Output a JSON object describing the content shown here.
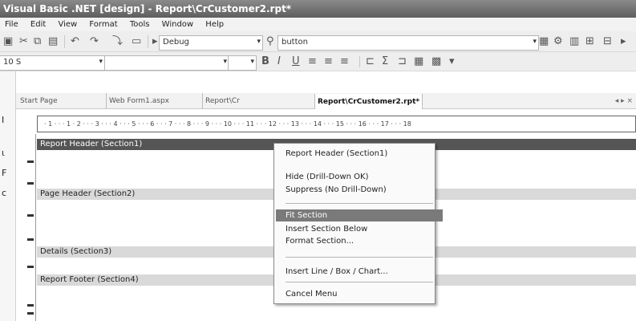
{
  "window": {
    "title": "Visual Basic .NET [design] - Report\\CrCustomer2.rpt*"
  },
  "menubar": {
    "items": [
      "File",
      "Edit",
      "View",
      "Format",
      "Tools",
      "Window",
      "Help"
    ]
  },
  "toolbar": {
    "config_value": "Debug",
    "search_value": "button",
    "font_value": "10 S",
    "font_style_value": "",
    "size_value": ""
  },
  "tabs": [
    {
      "label": "Start Page"
    },
    {
      "label": "Web Form1.aspx"
    },
    {
      "label": "Report\\Cr"
    },
    {
      "label": "Report\\CrCustomer2.rpt*"
    }
  ],
  "tab_nav": "◂ ▸ ×",
  "ruler_text": "· 1 · · · 1 · 2 · · · 3 · · · 4 · · · 5 · · · 6 · · · 7 · · · 8 · · · 9 · · · 10 · · · 11 · · · 12 · · · 13 · · · 14 · · · 15 · · · 16 · · · 17 · · · 18",
  "sections": [
    {
      "label": "Report Header (Section1)",
      "style": "dark"
    },
    {
      "label": "Page Header (Section2)",
      "style": "light"
    },
    {
      "label": "Details (Section3)",
      "style": "light"
    },
    {
      "label": "Report Footer (Section4)",
      "style": "light"
    }
  ],
  "context_menu": {
    "items": [
      {
        "label": "Report Header (Section1)",
        "highlight": false
      },
      {
        "label": "Hide (Drill-Down OK)",
        "highlight": false
      },
      {
        "label": "Suppress (No Drill-Down)",
        "highlight": false
      },
      {
        "label": "Fit Section",
        "highlight": true
      },
      {
        "label": "Insert Section Below",
        "highlight": false
      },
      {
        "label": "Format Section...",
        "highlight": false
      },
      {
        "label": "Insert Line / Box / Chart...",
        "highlight": false
      },
      {
        "label": "Cancel Menu",
        "highlight": false
      }
    ]
  },
  "colors": {
    "highlight": "#7a7a7a",
    "section_dark": "#555555",
    "title_bar": "#6a6a6a"
  }
}
